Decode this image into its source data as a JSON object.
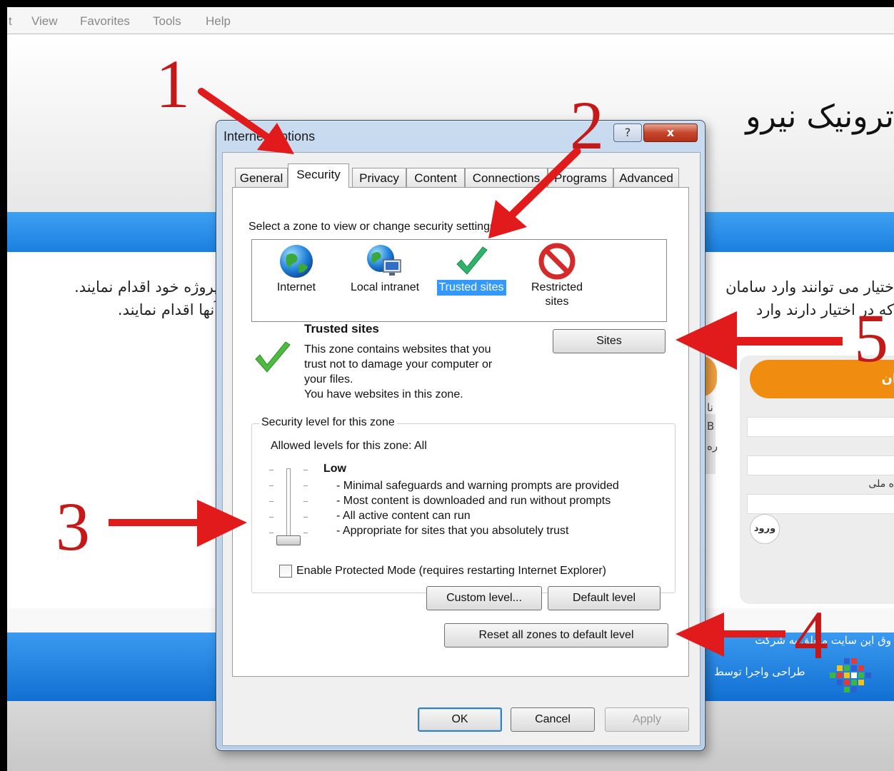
{
  "menubar": {
    "items": [
      "t",
      "View",
      "Favorites",
      "Tools",
      "Help"
    ]
  },
  "site": {
    "title": "ترونیک نیرو",
    "line1_left": "پروژه خود اقدام نمایند.",
    "line2_left": "آنها اقدام نمایند.",
    "line1_right": "ختیار می توانند وارد سامان",
    "line2_right": "که در اختیار دارند وارد",
    "login_header": "ان",
    "login_label": "ه ملی",
    "login_button": "ورود",
    "side_chars": [
      "نا",
      "B",
      "ره"
    ],
    "footer_line1": "وق این سایت متعلق به شرکت",
    "footer_line2": "طراحی واجرا توسط"
  },
  "dialog": {
    "title": "Internet Options",
    "help_glyph": "?",
    "close_glyph": "x",
    "tabs": [
      "General",
      "Security",
      "Privacy",
      "Content",
      "Connections",
      "Programs",
      "Advanced"
    ],
    "active_tab": "Security",
    "zone_prompt": "Select a zone to view or change security settings.",
    "zones": [
      {
        "label": "Internet",
        "icon": "globe-icon"
      },
      {
        "label": "Local intranet",
        "icon": "intranet-icon"
      },
      {
        "label": "Trusted sites",
        "icon": "checkmark-icon",
        "selected": true
      },
      {
        "label": "Restricted sites",
        "icon": "restricted-icon"
      }
    ],
    "zone_info": {
      "heading": "Trusted sites",
      "description": [
        "This zone contains websites that you",
        "trust not to damage your computer or",
        "your files."
      ],
      "status": "You have websites in this zone.",
      "sites_button": "Sites"
    },
    "security_level": {
      "legend": "Security level for this zone",
      "allowed": "Allowed levels for this zone: All",
      "level": "Low",
      "level_fraction": 0,
      "bullets": [
        "- Minimal safeguards and warning prompts are provided",
        "- Most content is downloaded and run without prompts",
        "- All active content can run",
        "- Appropriate for sites that you absolutely trust"
      ],
      "protected_mode_label": "Enable Protected Mode (requires restarting Internet Explorer)",
      "protected_mode_checked": false,
      "custom_button": "Custom level...",
      "default_button": "Default level"
    },
    "reset_button": "Reset all zones to default level",
    "ok_button": "OK",
    "cancel_button": "Cancel",
    "apply_button": "Apply"
  },
  "annotations": {
    "numbers": [
      "1",
      "2",
      "3",
      "4",
      "5"
    ],
    "color": "#e11b1b"
  }
}
